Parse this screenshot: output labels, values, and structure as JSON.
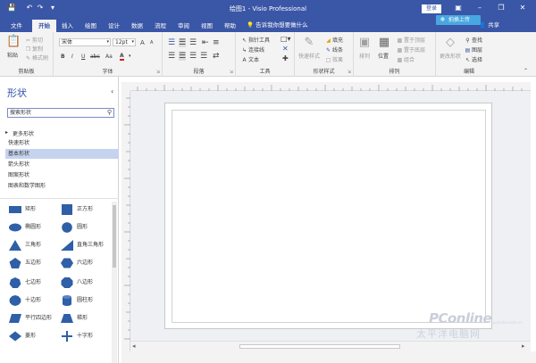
{
  "titlebar": {
    "title": "绘图1 - Visio Professional",
    "login": "登录",
    "save_icon": "save-icon",
    "undo_icon": "undo-icon",
    "redo_icon": "redo-icon",
    "customize_icon": "customize-icon"
  },
  "tabs": [
    "文件",
    "开始",
    "插入",
    "绘图",
    "设计",
    "数据",
    "流程",
    "审阅",
    "视图",
    "帮助"
  ],
  "active_tab": "开始",
  "tellme": "告诉我你想要做什么",
  "share": "共享",
  "overlay_button": "拍换上传",
  "ribbon": {
    "clipboard": {
      "paste": "粘贴",
      "cut": "剪切",
      "copy": "复制",
      "format_painter": "格式刷",
      "label": "剪贴板"
    },
    "font": {
      "font_name": "宋体",
      "font_size": "12pt",
      "bold": "B",
      "italic": "I",
      "underline": "U",
      "strike": "abc",
      "aa": "Aa",
      "font_color": "A",
      "grow": "A",
      "shrink": "A",
      "label": "字体"
    },
    "paragraph": {
      "label": "段落"
    },
    "tools": {
      "pointer": "指针工具",
      "connector": "连接线",
      "text": "文本",
      "label": "工具"
    },
    "shape_styles": {
      "quick_styles": "快速样式",
      "fill": "填充",
      "line": "线条",
      "effects": "效果",
      "label": "形状样式"
    },
    "arrange": {
      "arrange": "排列",
      "position": "位置",
      "bring_front": "置于顶层",
      "send_back": "置于底层",
      "group": "组合",
      "label": "排列"
    },
    "editing": {
      "change_shape": "更改形状",
      "find": "查找",
      "layers": "图层",
      "select": "选择",
      "label": "编辑"
    }
  },
  "sidebar": {
    "title": "形状",
    "search_placeholder": "搜索形状",
    "more_shapes": "更多形状",
    "stencils": [
      "快速形状",
      "基本形状",
      "箭头形状",
      "图案形状",
      "图表和数学图形"
    ],
    "selected_stencil": "基本形状",
    "shapes": [
      {
        "name": "矩形",
        "icon": "rectangle"
      },
      {
        "name": "正方形",
        "icon": "square"
      },
      {
        "name": "椭圆形",
        "icon": "ellipse"
      },
      {
        "name": "圆形",
        "icon": "circle"
      },
      {
        "name": "三角形",
        "icon": "triangle"
      },
      {
        "name": "直角三角形",
        "icon": "right-triangle"
      },
      {
        "name": "五边形",
        "icon": "pentagon"
      },
      {
        "name": "六边形",
        "icon": "hexagon"
      },
      {
        "name": "七边形",
        "icon": "heptagon"
      },
      {
        "name": "八边形",
        "icon": "octagon"
      },
      {
        "name": "十边形",
        "icon": "decagon"
      },
      {
        "name": "圆柱形",
        "icon": "cylinder"
      },
      {
        "name": "平行四边形",
        "icon": "parallelogram"
      },
      {
        "name": "梯形",
        "icon": "trapezoid"
      },
      {
        "name": "菱形",
        "icon": "diamond"
      },
      {
        "name": "十字形",
        "icon": "cross"
      }
    ]
  },
  "watermark": {
    "brand": "PConline",
    "sub": "太平洋电脑网",
    "url": "pconline.com.cn"
  },
  "colors": {
    "accent": "#3a56a6",
    "shape_fill": "#2f5fa7",
    "selected_stencil": "#c5d3ef",
    "overlay": "#48a7e0"
  }
}
